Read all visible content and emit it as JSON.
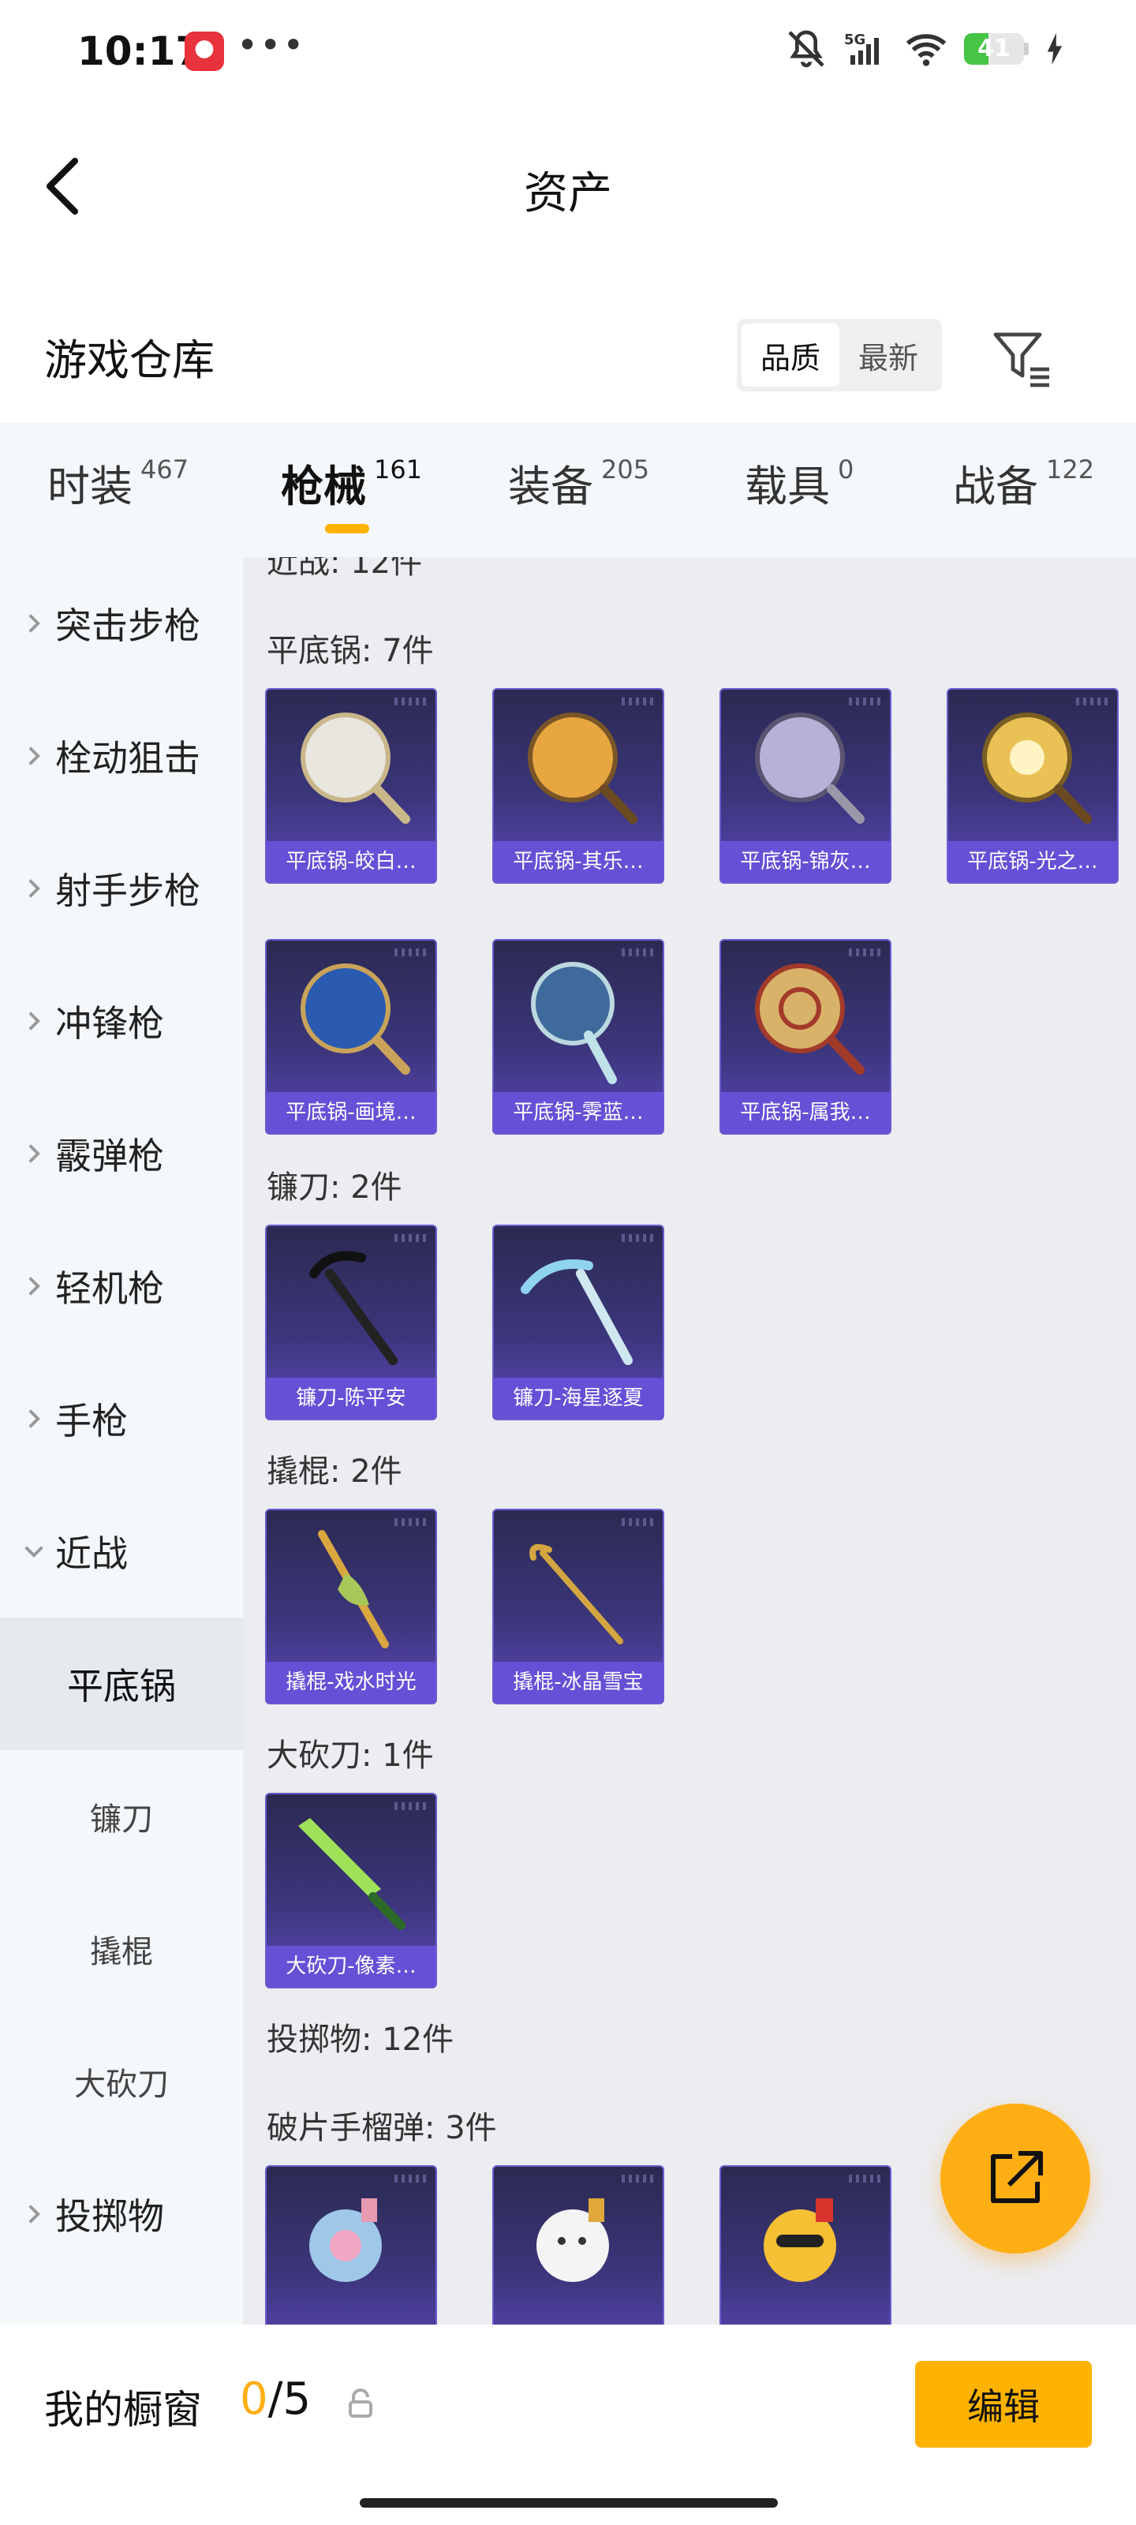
{
  "status_bar": {
    "time": "10:17",
    "dots": "•••",
    "network": "5G",
    "battery": "41",
    "battery_level": 0.41
  },
  "header": {
    "title": "资产"
  },
  "warehouse": {
    "title": "游戏仓库",
    "sort_options": [
      "品质",
      "最新"
    ],
    "active_sort": "品质"
  },
  "tabs": [
    {
      "label": "时装",
      "count": "467"
    },
    {
      "label": "枪械",
      "count": "161"
    },
    {
      "label": "装备",
      "count": "205"
    },
    {
      "label": "载具",
      "count": "0"
    },
    {
      "label": "战备",
      "count": "122"
    }
  ],
  "sidebar": {
    "items": [
      {
        "label": "突击步枪"
      },
      {
        "label": "栓动狙击"
      },
      {
        "label": "射手步枪"
      },
      {
        "label": "冲锋枪"
      },
      {
        "label": "霰弹枪"
      },
      {
        "label": "轻机枪"
      },
      {
        "label": "手枪"
      },
      {
        "label": "近战"
      },
      {
        "label": "平底锅"
      },
      {
        "label": "镰刀"
      },
      {
        "label": "撬棍"
      },
      {
        "label": "大砍刀"
      },
      {
        "label": "投掷物"
      }
    ]
  },
  "content": {
    "cut_section": "近战: 12件",
    "sections": [
      {
        "title": "平底锅: 7件",
        "items": [
          "平底锅-皎白…",
          "平底锅-其乐…",
          "平底锅-锦灰…",
          "平底锅-光之…",
          "平底锅-画境…",
          "平底锅-霁蓝…",
          "平底锅-属我…"
        ]
      },
      {
        "title": "镰刀: 2件",
        "items": [
          "镰刀-陈平安",
          "镰刀-海星逐夏"
        ]
      },
      {
        "title": "撬棍: 2件",
        "items": [
          "撬棍-戏水时光",
          "撬棍-冰晶雪宝"
        ]
      },
      {
        "title": "大砍刀: 1件",
        "items": [
          "大砍刀-像素…"
        ]
      },
      {
        "title": "投掷物: 12件"
      },
      {
        "title": "破片手榴弹: 3件"
      }
    ]
  },
  "bottom_bar": {
    "label": "我的橱窗",
    "current": "0",
    "sep_total": "/5",
    "edit_label": "编辑"
  },
  "colors": {
    "accent": "#ffb300",
    "card_label": "#6550d6"
  }
}
